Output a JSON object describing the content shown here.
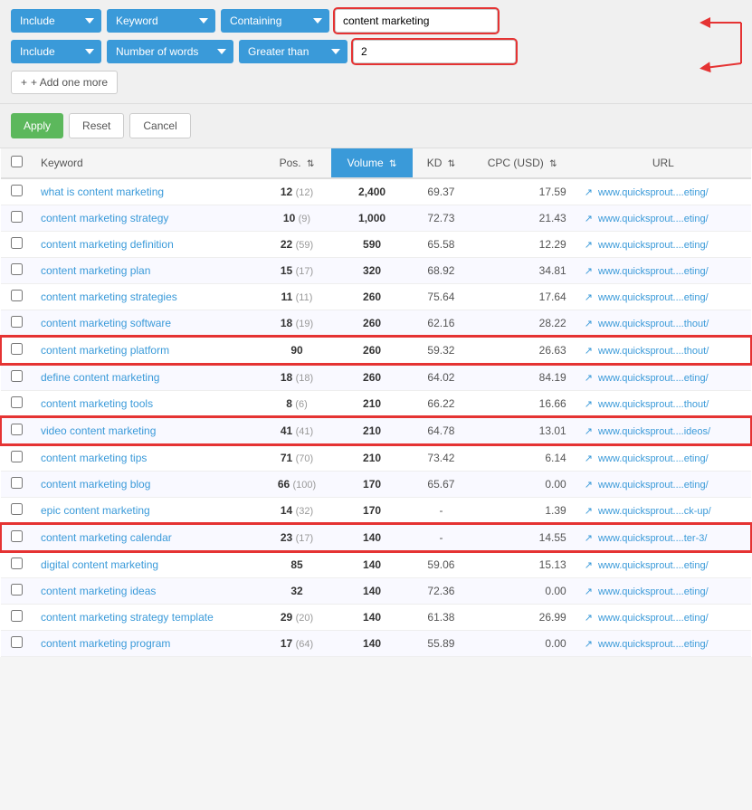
{
  "filters": {
    "row1": {
      "include_label": "Include",
      "keyword_label": "Keyword",
      "containing_label": "Containing",
      "text_value": "content marketing"
    },
    "row2": {
      "include_label": "Include",
      "number_of_words_label": "Number of words",
      "greater_than_label": "Greater than",
      "number_value": "2"
    },
    "add_button": "+ Add one more",
    "apply_button": "Apply",
    "reset_button": "Reset",
    "cancel_button": "Cancel"
  },
  "table": {
    "columns": [
      "",
      "Keyword",
      "Pos.",
      "Volume",
      "KD",
      "CPC (USD)",
      "URL"
    ],
    "rows": [
      {
        "keyword": "what is content marketing",
        "pos": "12",
        "pos_sub": "(12)",
        "volume": "2,400",
        "kd": "69.37",
        "cpc": "17.59",
        "url": "www.quicksprout....eting/",
        "highlighted": false
      },
      {
        "keyword": "content marketing strategy",
        "pos": "10",
        "pos_sub": "(9)",
        "volume": "1,000",
        "kd": "72.73",
        "cpc": "21.43",
        "url": "www.quicksprout....eting/",
        "highlighted": false
      },
      {
        "keyword": "content marketing definition",
        "pos": "22",
        "pos_sub": "(59)",
        "volume": "590",
        "kd": "65.58",
        "cpc": "12.29",
        "url": "www.quicksprout....eting/",
        "highlighted": false
      },
      {
        "keyword": "content marketing plan",
        "pos": "15",
        "pos_sub": "(17)",
        "volume": "320",
        "kd": "68.92",
        "cpc": "34.81",
        "url": "www.quicksprout....eting/",
        "highlighted": false
      },
      {
        "keyword": "content marketing strategies",
        "pos": "11",
        "pos_sub": "(11)",
        "volume": "260",
        "kd": "75.64",
        "cpc": "17.64",
        "url": "www.quicksprout....eting/",
        "highlighted": false
      },
      {
        "keyword": "content marketing software",
        "pos": "18",
        "pos_sub": "(19)",
        "volume": "260",
        "kd": "62.16",
        "cpc": "28.22",
        "url": "www.quicksprout....thout/",
        "highlighted": false
      },
      {
        "keyword": "content marketing platform",
        "pos": "90",
        "pos_sub": "",
        "volume": "260",
        "kd": "59.32",
        "cpc": "26.63",
        "url": "www.quicksprout....thout/",
        "highlighted": true
      },
      {
        "keyword": "define content marketing",
        "pos": "18",
        "pos_sub": "(18)",
        "volume": "260",
        "kd": "64.02",
        "cpc": "84.19",
        "url": "www.quicksprout....eting/",
        "highlighted": false
      },
      {
        "keyword": "content marketing tools",
        "pos": "8",
        "pos_sub": "(6)",
        "volume": "210",
        "kd": "66.22",
        "cpc": "16.66",
        "url": "www.quicksprout....thout/",
        "highlighted": false
      },
      {
        "keyword": "video content marketing",
        "pos": "41",
        "pos_sub": "(41)",
        "volume": "210",
        "kd": "64.78",
        "cpc": "13.01",
        "url": "www.quicksprout....ideos/",
        "highlighted": true
      },
      {
        "keyword": "content marketing tips",
        "pos": "71",
        "pos_sub": "(70)",
        "volume": "210",
        "kd": "73.42",
        "cpc": "6.14",
        "url": "www.quicksprout....eting/",
        "highlighted": false
      },
      {
        "keyword": "content marketing blog",
        "pos": "66",
        "pos_sub": "(100)",
        "volume": "170",
        "kd": "65.67",
        "cpc": "0.00",
        "url": "www.quicksprout....eting/",
        "highlighted": false
      },
      {
        "keyword": "epic content marketing",
        "pos": "14",
        "pos_sub": "(32)",
        "volume": "170",
        "kd": "-",
        "cpc": "1.39",
        "url": "www.quicksprout....ck-up/",
        "highlighted": false
      },
      {
        "keyword": "content marketing calendar",
        "pos": "23",
        "pos_sub": "(17)",
        "volume": "140",
        "kd": "-",
        "cpc": "14.55",
        "url": "www.quicksprout....ter-3/",
        "highlighted": true
      },
      {
        "keyword": "digital content marketing",
        "pos": "85",
        "pos_sub": "",
        "volume": "140",
        "kd": "59.06",
        "cpc": "15.13",
        "url": "www.quicksprout....eting/",
        "highlighted": false
      },
      {
        "keyword": "content marketing ideas",
        "pos": "32",
        "pos_sub": "",
        "volume": "140",
        "kd": "72.36",
        "cpc": "0.00",
        "url": "www.quicksprout....eting/",
        "highlighted": false
      },
      {
        "keyword": "content marketing strategy template",
        "pos": "29",
        "pos_sub": "(20)",
        "volume": "140",
        "kd": "61.38",
        "cpc": "26.99",
        "url": "www.quicksprout....eting/",
        "highlighted": false
      },
      {
        "keyword": "content marketing program",
        "pos": "17",
        "pos_sub": "(64)",
        "volume": "140",
        "kd": "55.89",
        "cpc": "0.00",
        "url": "www.quicksprout....eting/",
        "highlighted": false
      }
    ]
  },
  "icons": {
    "external_link": "↗",
    "sort_asc_desc": "⇅",
    "sort_active": "⇅",
    "plus": "+"
  }
}
